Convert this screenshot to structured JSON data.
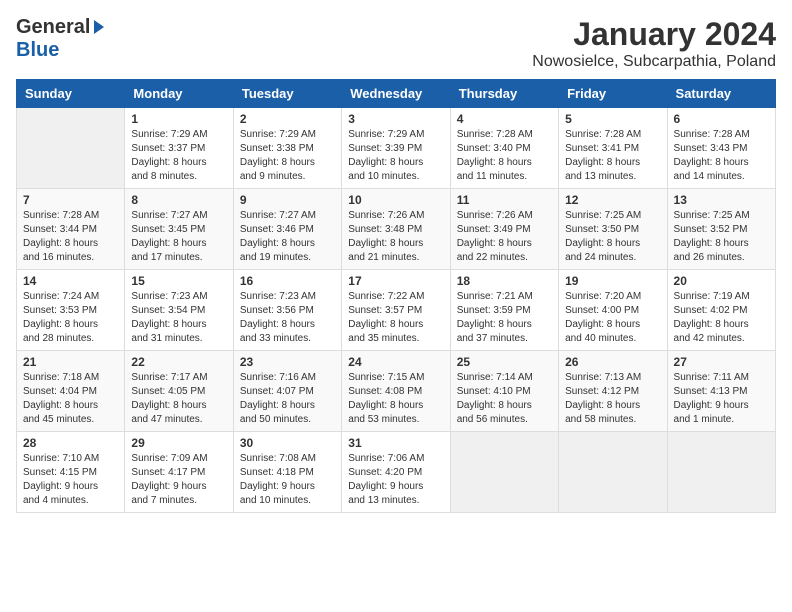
{
  "header": {
    "logo_general": "General",
    "logo_blue": "Blue",
    "month_year": "January 2024",
    "location": "Nowosielce, Subcarpathia, Poland"
  },
  "days_of_week": [
    "Sunday",
    "Monday",
    "Tuesday",
    "Wednesday",
    "Thursday",
    "Friday",
    "Saturday"
  ],
  "weeks": [
    [
      {
        "day": "",
        "info": ""
      },
      {
        "day": "1",
        "info": "Sunrise: 7:29 AM\nSunset: 3:37 PM\nDaylight: 8 hours\nand 8 minutes."
      },
      {
        "day": "2",
        "info": "Sunrise: 7:29 AM\nSunset: 3:38 PM\nDaylight: 8 hours\nand 9 minutes."
      },
      {
        "day": "3",
        "info": "Sunrise: 7:29 AM\nSunset: 3:39 PM\nDaylight: 8 hours\nand 10 minutes."
      },
      {
        "day": "4",
        "info": "Sunrise: 7:28 AM\nSunset: 3:40 PM\nDaylight: 8 hours\nand 11 minutes."
      },
      {
        "day": "5",
        "info": "Sunrise: 7:28 AM\nSunset: 3:41 PM\nDaylight: 8 hours\nand 13 minutes."
      },
      {
        "day": "6",
        "info": "Sunrise: 7:28 AM\nSunset: 3:43 PM\nDaylight: 8 hours\nand 14 minutes."
      }
    ],
    [
      {
        "day": "7",
        "info": "Sunrise: 7:28 AM\nSunset: 3:44 PM\nDaylight: 8 hours\nand 16 minutes."
      },
      {
        "day": "8",
        "info": "Sunrise: 7:27 AM\nSunset: 3:45 PM\nDaylight: 8 hours\nand 17 minutes."
      },
      {
        "day": "9",
        "info": "Sunrise: 7:27 AM\nSunset: 3:46 PM\nDaylight: 8 hours\nand 19 minutes."
      },
      {
        "day": "10",
        "info": "Sunrise: 7:26 AM\nSunset: 3:48 PM\nDaylight: 8 hours\nand 21 minutes."
      },
      {
        "day": "11",
        "info": "Sunrise: 7:26 AM\nSunset: 3:49 PM\nDaylight: 8 hours\nand 22 minutes."
      },
      {
        "day": "12",
        "info": "Sunrise: 7:25 AM\nSunset: 3:50 PM\nDaylight: 8 hours\nand 24 minutes."
      },
      {
        "day": "13",
        "info": "Sunrise: 7:25 AM\nSunset: 3:52 PM\nDaylight: 8 hours\nand 26 minutes."
      }
    ],
    [
      {
        "day": "14",
        "info": "Sunrise: 7:24 AM\nSunset: 3:53 PM\nDaylight: 8 hours\nand 28 minutes."
      },
      {
        "day": "15",
        "info": "Sunrise: 7:23 AM\nSunset: 3:54 PM\nDaylight: 8 hours\nand 31 minutes."
      },
      {
        "day": "16",
        "info": "Sunrise: 7:23 AM\nSunset: 3:56 PM\nDaylight: 8 hours\nand 33 minutes."
      },
      {
        "day": "17",
        "info": "Sunrise: 7:22 AM\nSunset: 3:57 PM\nDaylight: 8 hours\nand 35 minutes."
      },
      {
        "day": "18",
        "info": "Sunrise: 7:21 AM\nSunset: 3:59 PM\nDaylight: 8 hours\nand 37 minutes."
      },
      {
        "day": "19",
        "info": "Sunrise: 7:20 AM\nSunset: 4:00 PM\nDaylight: 8 hours\nand 40 minutes."
      },
      {
        "day": "20",
        "info": "Sunrise: 7:19 AM\nSunset: 4:02 PM\nDaylight: 8 hours\nand 42 minutes."
      }
    ],
    [
      {
        "day": "21",
        "info": "Sunrise: 7:18 AM\nSunset: 4:04 PM\nDaylight: 8 hours\nand 45 minutes."
      },
      {
        "day": "22",
        "info": "Sunrise: 7:17 AM\nSunset: 4:05 PM\nDaylight: 8 hours\nand 47 minutes."
      },
      {
        "day": "23",
        "info": "Sunrise: 7:16 AM\nSunset: 4:07 PM\nDaylight: 8 hours\nand 50 minutes."
      },
      {
        "day": "24",
        "info": "Sunrise: 7:15 AM\nSunset: 4:08 PM\nDaylight: 8 hours\nand 53 minutes."
      },
      {
        "day": "25",
        "info": "Sunrise: 7:14 AM\nSunset: 4:10 PM\nDaylight: 8 hours\nand 56 minutes."
      },
      {
        "day": "26",
        "info": "Sunrise: 7:13 AM\nSunset: 4:12 PM\nDaylight: 8 hours\nand 58 minutes."
      },
      {
        "day": "27",
        "info": "Sunrise: 7:11 AM\nSunset: 4:13 PM\nDaylight: 9 hours\nand 1 minute."
      }
    ],
    [
      {
        "day": "28",
        "info": "Sunrise: 7:10 AM\nSunset: 4:15 PM\nDaylight: 9 hours\nand 4 minutes."
      },
      {
        "day": "29",
        "info": "Sunrise: 7:09 AM\nSunset: 4:17 PM\nDaylight: 9 hours\nand 7 minutes."
      },
      {
        "day": "30",
        "info": "Sunrise: 7:08 AM\nSunset: 4:18 PM\nDaylight: 9 hours\nand 10 minutes."
      },
      {
        "day": "31",
        "info": "Sunrise: 7:06 AM\nSunset: 4:20 PM\nDaylight: 9 hours\nand 13 minutes."
      },
      {
        "day": "",
        "info": ""
      },
      {
        "day": "",
        "info": ""
      },
      {
        "day": "",
        "info": ""
      }
    ]
  ]
}
